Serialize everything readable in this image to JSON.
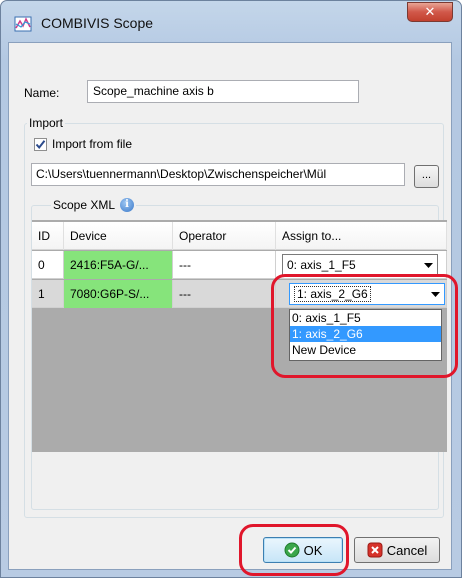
{
  "window": {
    "title": "COMBIVIS Scope",
    "close_label": "✕"
  },
  "name": {
    "label": "Name:",
    "value": "Scope_machine axis b"
  },
  "import": {
    "legend": "Import",
    "checkbox_label": "Import from file",
    "checkbox_checked": true,
    "path_value": "C:\\Users\\tuennermann\\Desktop\\Zwischenspeicher\\Mül",
    "browse_label": "..."
  },
  "scope_xml": {
    "legend": "Scope XML",
    "columns": [
      "ID",
      "Device",
      "Operator",
      "Assign to..."
    ],
    "rows": [
      {
        "id": "0",
        "device": "2416:F5A-G/...",
        "operator": "---",
        "assign": "0: axis_1_F5"
      },
      {
        "id": "1",
        "device": "7080:G6P-S/...",
        "operator": "---",
        "assign": "1: axis_2_G6"
      }
    ],
    "dropdown_options": [
      "0: axis_1_F5",
      "1: axis_2_G6",
      "New Device"
    ],
    "dropdown_selected": "1: axis_2_G6"
  },
  "buttons": {
    "ok": "OK",
    "cancel": "Cancel"
  },
  "colors": {
    "device_cell": "#86e47b",
    "highlight": "#e0162b",
    "selection": "#3399ff"
  }
}
